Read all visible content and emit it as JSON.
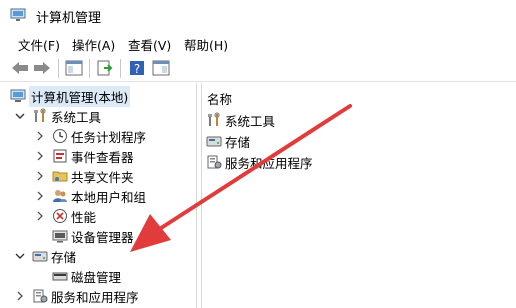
{
  "window": {
    "title": "计算机管理"
  },
  "menu": {
    "items": [
      {
        "label": "文件(F)"
      },
      {
        "label": "操作(A)"
      },
      {
        "label": "查看(V)"
      },
      {
        "label": "帮助(H)"
      }
    ]
  },
  "toolbar": {
    "buttons": [
      "back-icon",
      "forward-icon",
      "show-hide-tree-icon",
      "export-list-icon",
      "help-icon",
      "properties-pane-icon"
    ]
  },
  "tree": {
    "root": "计算机管理(本地)",
    "system_tools": "系统工具",
    "task_scheduler": "任务计划程序",
    "event_viewer": "事件查看器",
    "shared_folders": "共享文件夹",
    "local_users": "本地用户和组",
    "performance": "性能",
    "device_manager": "设备管理器",
    "storage": "存储",
    "disk_management": "磁盘管理",
    "services_apps": "服务和应用程序"
  },
  "list": {
    "column_name": "名称",
    "items": [
      {
        "label": "系统工具",
        "icon": "tools-icon"
      },
      {
        "label": "存储",
        "icon": "storage-icon"
      },
      {
        "label": "服务和应用程序",
        "icon": "services-icon"
      }
    ]
  },
  "annotation": {
    "arrow_color": "#e23b3b"
  },
  "colors": {
    "selection": "#dce9f7",
    "accent": "#1f6fc5"
  }
}
